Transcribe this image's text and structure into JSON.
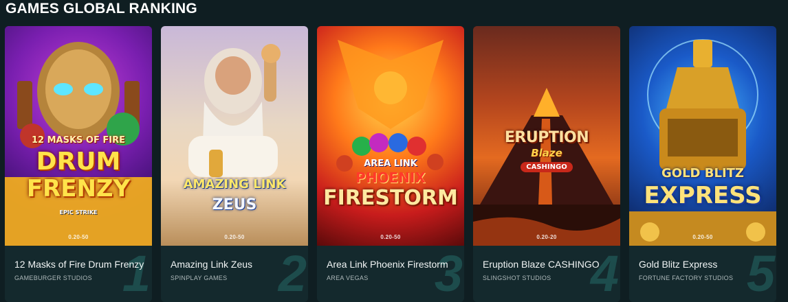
{
  "section": {
    "title": "GAMES GLOBAL RANKING"
  },
  "games": [
    {
      "rank": "1",
      "name": "12 Masks of Fire Drum Frenzy",
      "studio": "GAMEBURGER STUDIOS",
      "stake": "0.20-50",
      "logo": {
        "line1": "12 MASKS OF FIRE",
        "line2": "DRUM",
        "line3": "FRENZY",
        "badge": "EPIC STRIKE"
      }
    },
    {
      "rank": "2",
      "name": "Amazing Link Zeus",
      "studio": "SPINPLAY GAMES",
      "stake": "0.20-50",
      "logo": {
        "line1": "AMAZING LINK",
        "line2": "ZEUS"
      }
    },
    {
      "rank": "3",
      "name": "Area Link Phoenix Firestorm",
      "studio": "AREA VEGAS",
      "stake": "0.20-50",
      "logo": {
        "line1": "AREA LINK",
        "line2": "PHOENIX",
        "line3": "FIRESTORM"
      }
    },
    {
      "rank": "4",
      "name": "Eruption Blaze CASHINGO",
      "studio": "SLINGSHOT STUDIOS",
      "stake": "0.20-20",
      "logo": {
        "line1": "ERUPTION",
        "line2": "Blaze",
        "line3": "CASHINGO"
      }
    },
    {
      "rank": "5",
      "name": "Gold Blitz Express",
      "studio": "FORTUNE FACTORY STUDIOS",
      "stake": "0.20-50",
      "logo": {
        "line1": "GOLD BLITZ",
        "line2": "EXPRESS"
      }
    }
  ],
  "colors": {
    "page_bg": "#0f1e22",
    "card_bg": "#14292d",
    "rank_number": "#1e4f4f",
    "studio_text": "#aeb9ba"
  }
}
